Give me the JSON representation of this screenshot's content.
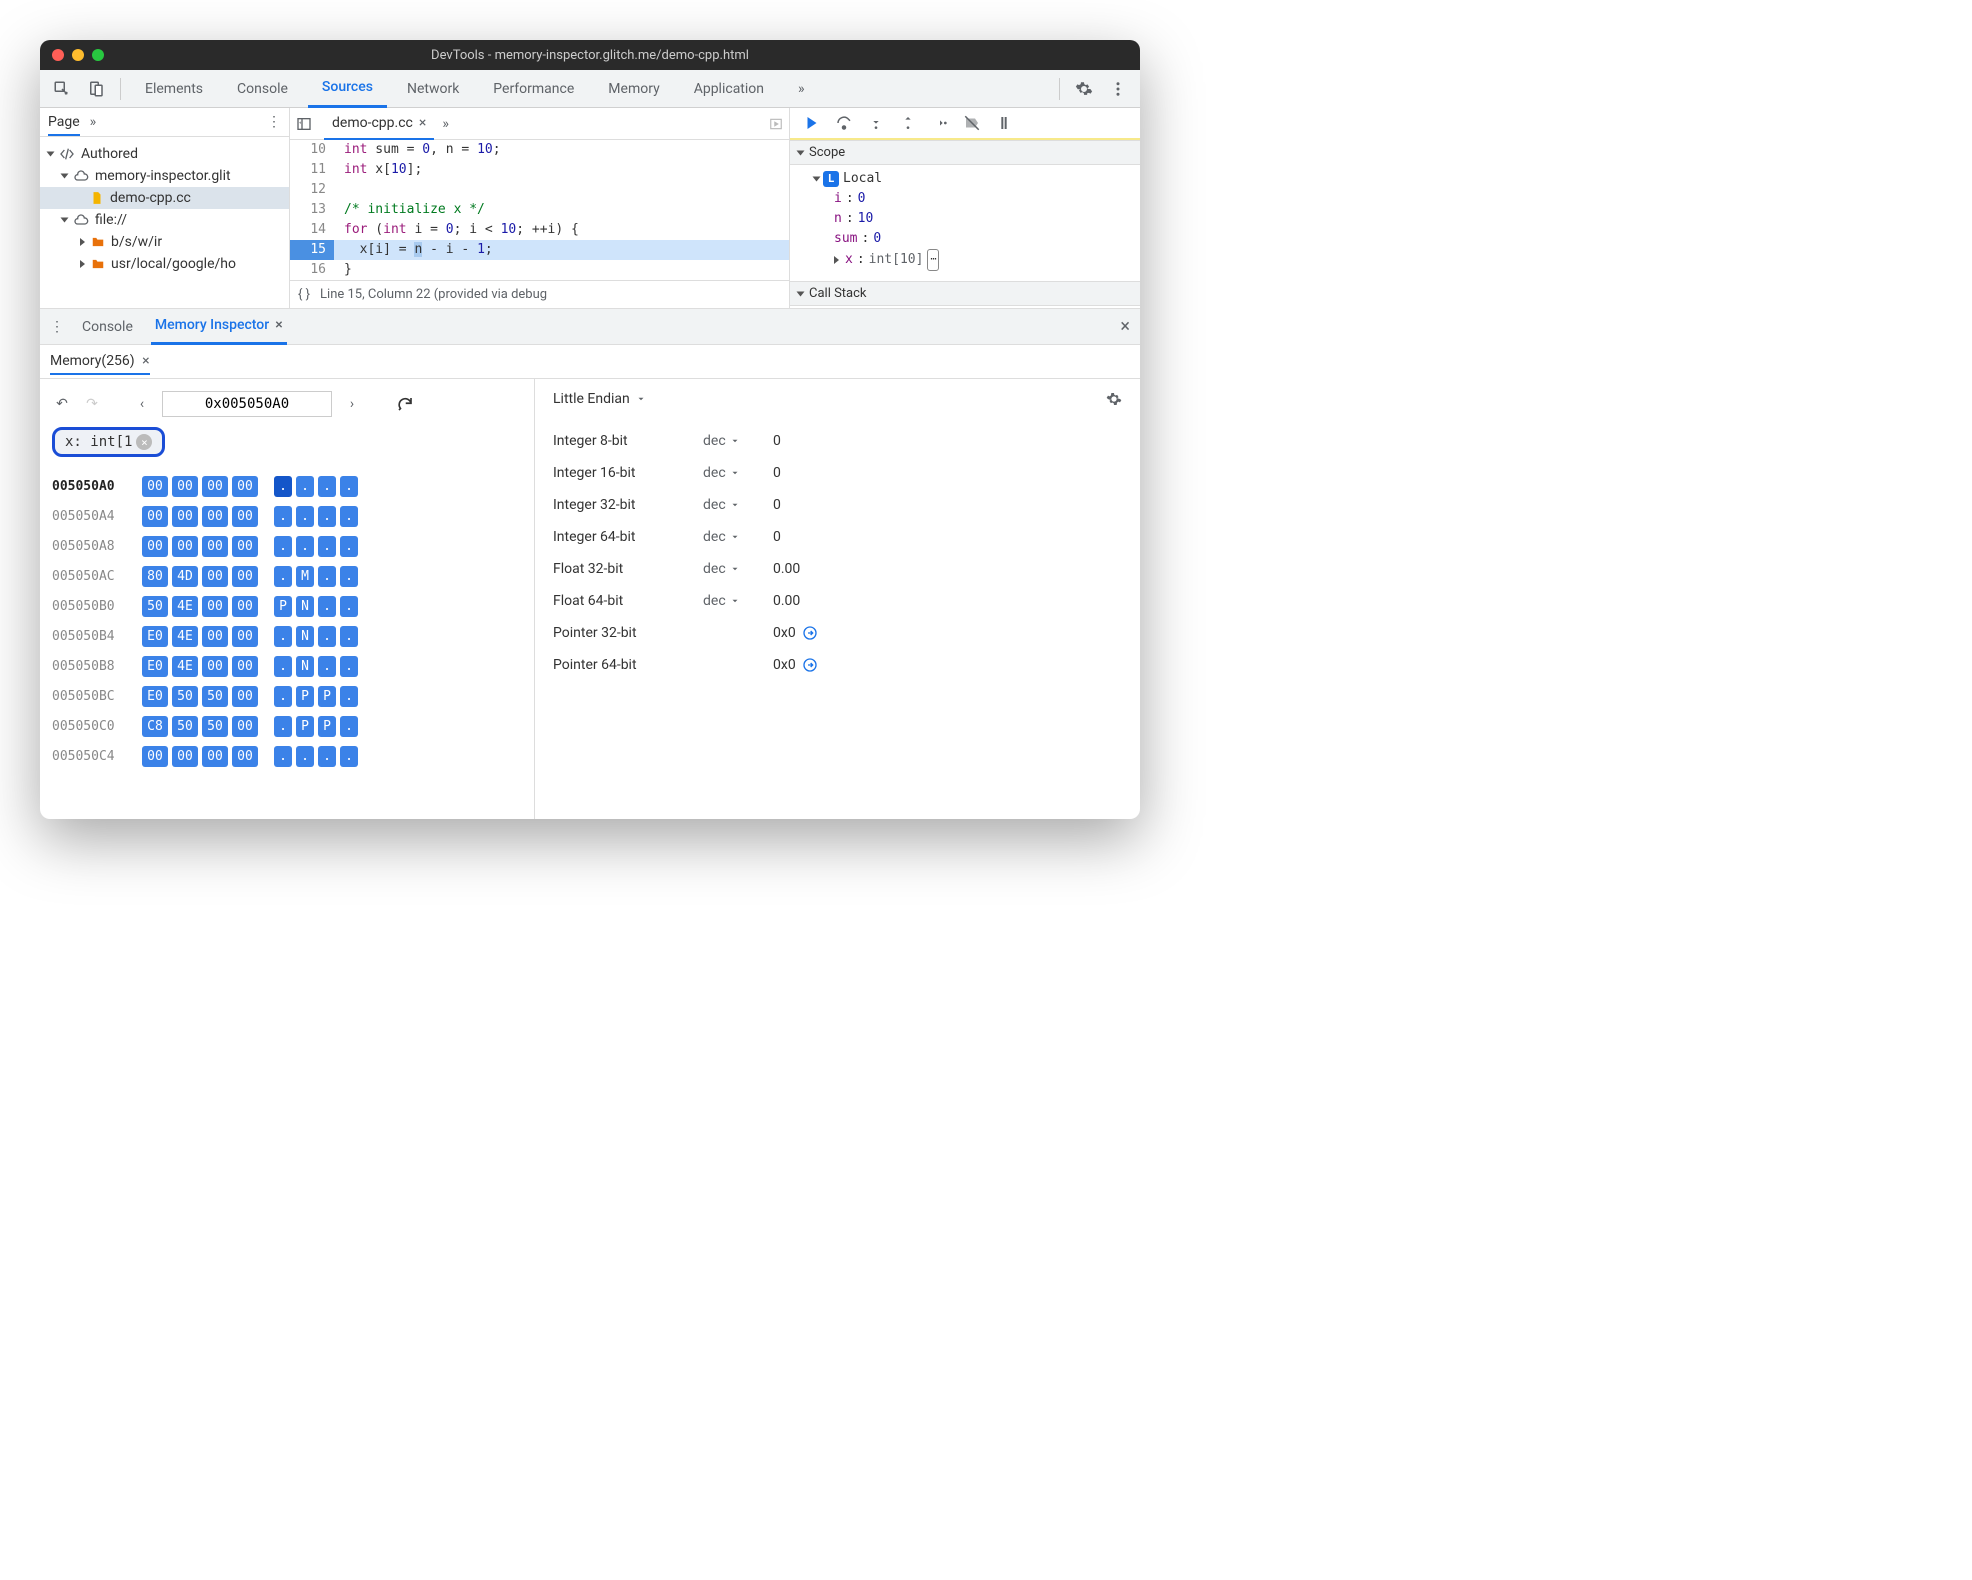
{
  "window": {
    "title": "DevTools - memory-inspector.glitch.me/demo-cpp.html"
  },
  "tabs": {
    "items": [
      "Elements",
      "Console",
      "Sources",
      "Network",
      "Performance",
      "Memory",
      "Application"
    ],
    "active": "Sources",
    "more": "»"
  },
  "navigator": {
    "page_label": "Page",
    "more": "»",
    "tree": {
      "authored": "Authored",
      "domain": "memory-inspector.glit",
      "file": "demo-cpp.cc",
      "file_proto": "file://",
      "folder1": "b/s/w/ir",
      "folder2": "usr/local/google/ho"
    }
  },
  "editor": {
    "open_file": "demo-cpp.cc",
    "more": "»",
    "lines": [
      {
        "n": 10,
        "html": "<span class='kw'>int</span> sum = <span class='num'>0</span>, n = <span class='num'>10</span>;"
      },
      {
        "n": 11,
        "html": "<span class='kw'>int</span> x[<span class='num'>10</span>];"
      },
      {
        "n": 12,
        "html": ""
      },
      {
        "n": 13,
        "html": "<span class='cmt'>/* initialize x */</span>"
      },
      {
        "n": 14,
        "html": "<span class='kw'>for</span> (<span class='kw'>int</span> i = <span class='num'>0</span>; i &lt; <span class='num'>10</span>; ++i) {"
      },
      {
        "n": 15,
        "hl": true,
        "html": "  x[i] = <span class='var-hl'>n</span> - i - <span class='num'>1</span>;"
      },
      {
        "n": 16,
        "html": "}"
      }
    ],
    "status": "Line 15, Column 22 (provided via debug"
  },
  "scope": {
    "header": "Scope",
    "local": "Local",
    "vars": [
      {
        "name": "i",
        "value": "0"
      },
      {
        "name": "n",
        "value": "10"
      },
      {
        "name": "sum",
        "value": "0"
      },
      {
        "name": "x",
        "value": "int[10]",
        "expandable": true,
        "reveal": true
      }
    ],
    "callstack": "Call Stack"
  },
  "drawer": {
    "console": "Console",
    "mi": "Memory Inspector",
    "mem_tab": "Memory(256)"
  },
  "memory": {
    "address": "0x005050A0",
    "chip": "x: int[1",
    "endian": "Little Endian",
    "rows": [
      {
        "addr": "005050A0",
        "bold": true,
        "bytes": [
          "00",
          "00",
          "00",
          "00"
        ],
        "ascii": [
          ".",
          ".",
          ".",
          "."
        ],
        "dark": [
          true,
          false,
          false,
          false
        ]
      },
      {
        "addr": "005050A4",
        "bytes": [
          "00",
          "00",
          "00",
          "00"
        ],
        "ascii": [
          ".",
          ".",
          ".",
          "."
        ],
        "dark": [
          false,
          false,
          false,
          false
        ]
      },
      {
        "addr": "005050A8",
        "bytes": [
          "00",
          "00",
          "00",
          "00"
        ],
        "ascii": [
          ".",
          ".",
          ".",
          "."
        ],
        "dark": [
          false,
          false,
          false,
          false
        ]
      },
      {
        "addr": "005050AC",
        "bytes": [
          "80",
          "4D",
          "00",
          "00"
        ],
        "ascii": [
          ".",
          "M",
          ".",
          "."
        ],
        "dark": [
          false,
          false,
          false,
          false
        ]
      },
      {
        "addr": "005050B0",
        "bytes": [
          "50",
          "4E",
          "00",
          "00"
        ],
        "ascii": [
          "P",
          "N",
          ".",
          "."
        ],
        "dark": [
          false,
          false,
          false,
          false
        ]
      },
      {
        "addr": "005050B4",
        "bytes": [
          "E0",
          "4E",
          "00",
          "00"
        ],
        "ascii": [
          ".",
          "N",
          ".",
          "."
        ],
        "dark": [
          false,
          false,
          false,
          false
        ]
      },
      {
        "addr": "005050B8",
        "bytes": [
          "E0",
          "4E",
          "00",
          "00"
        ],
        "ascii": [
          ".",
          "N",
          ".",
          "."
        ],
        "dark": [
          false,
          false,
          false,
          false
        ]
      },
      {
        "addr": "005050BC",
        "bytes": [
          "E0",
          "50",
          "50",
          "00"
        ],
        "ascii": [
          ".",
          "P",
          "P",
          "."
        ],
        "dark": [
          false,
          false,
          false,
          false
        ]
      },
      {
        "addr": "005050C0",
        "bytes": [
          "C8",
          "50",
          "50",
          "00"
        ],
        "ascii": [
          ".",
          "P",
          "P",
          "."
        ],
        "dark": [
          false,
          false,
          false,
          false
        ]
      },
      {
        "addr": "005050C4",
        "bytes": [
          "00",
          "00",
          "00",
          "00"
        ],
        "ascii": [
          ".",
          ".",
          ".",
          "."
        ],
        "dark": [
          false,
          false,
          false,
          false
        ]
      }
    ],
    "values": [
      {
        "type": "Integer 8-bit",
        "fmt": "dec",
        "val": "0"
      },
      {
        "type": "Integer 16-bit",
        "fmt": "dec",
        "val": "0"
      },
      {
        "type": "Integer 32-bit",
        "fmt": "dec",
        "val": "0"
      },
      {
        "type": "Integer 64-bit",
        "fmt": "dec",
        "val": "0"
      },
      {
        "type": "Float 32-bit",
        "fmt": "dec",
        "val": "0.00"
      },
      {
        "type": "Float 64-bit",
        "fmt": "dec",
        "val": "0.00"
      },
      {
        "type": "Pointer 32-bit",
        "fmt": "",
        "val": "0x0",
        "jump": true
      },
      {
        "type": "Pointer 64-bit",
        "fmt": "",
        "val": "0x0",
        "jump": true
      }
    ]
  }
}
